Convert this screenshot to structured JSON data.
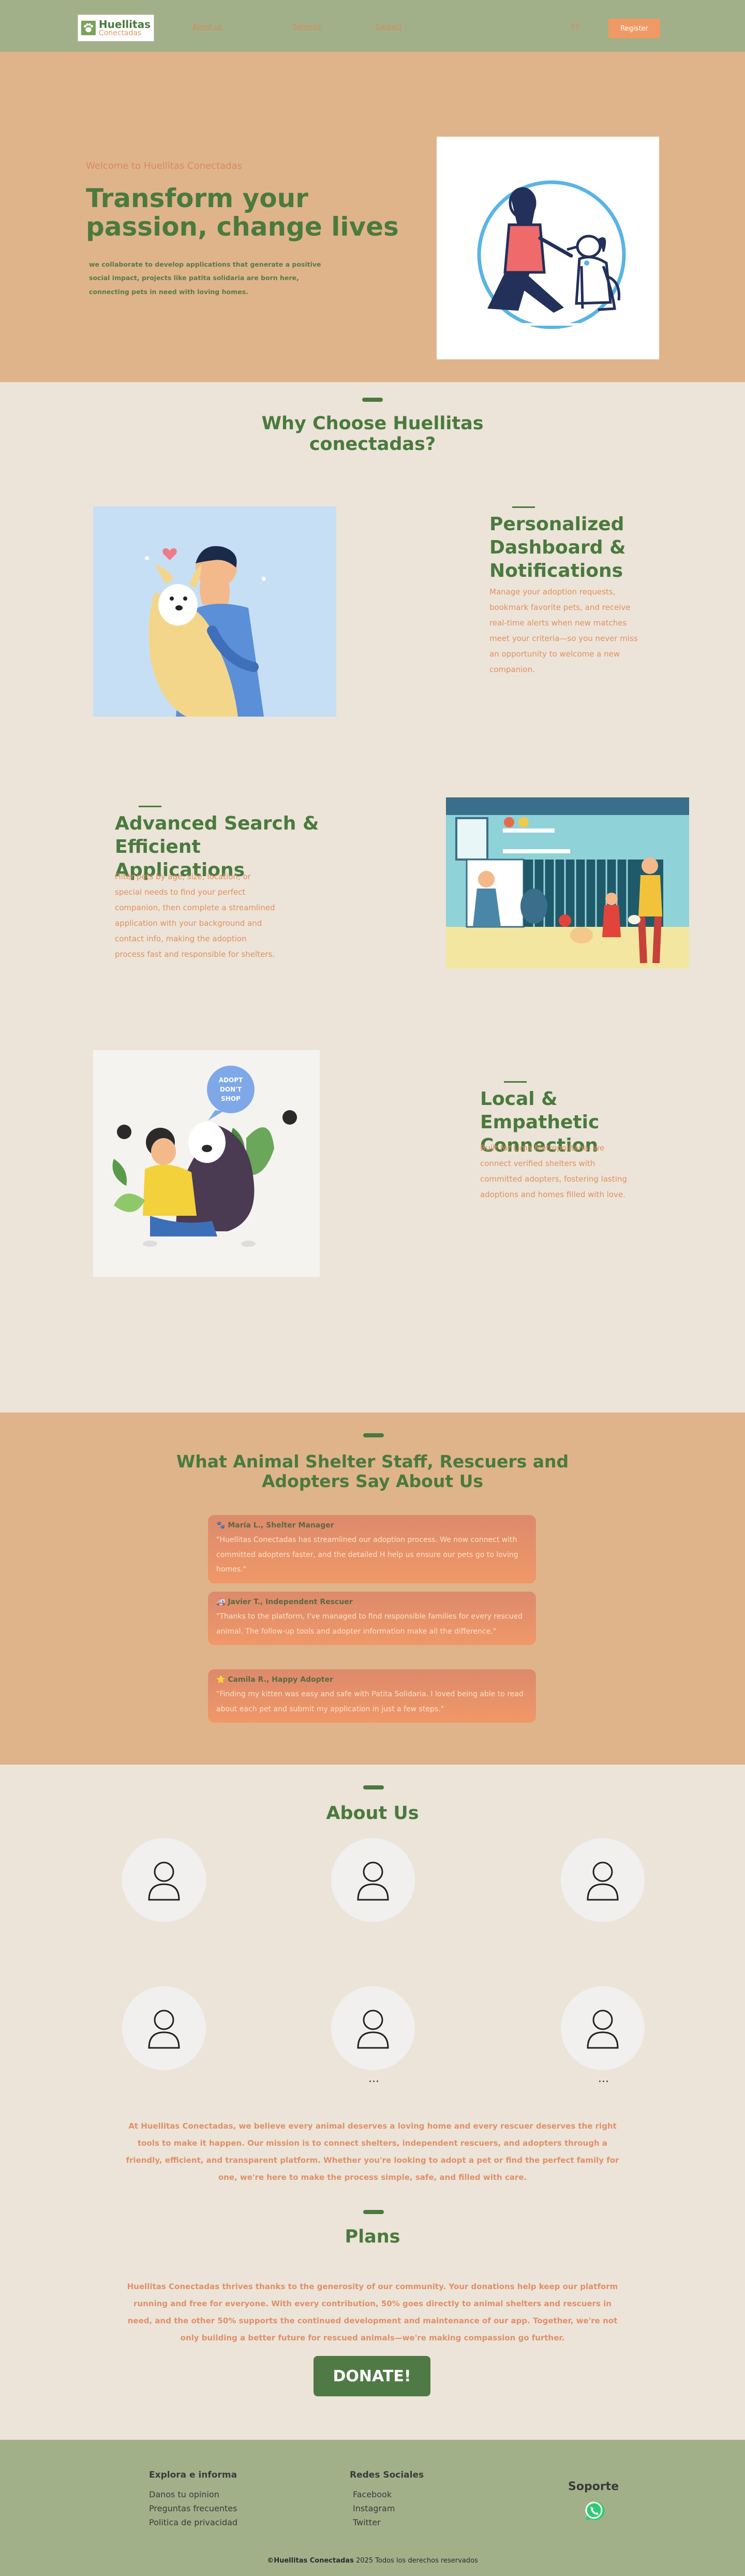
{
  "nav": {
    "logo_line1": "Huellitas",
    "logo_line2": "Conectadas",
    "links": [
      "About us",
      "Services",
      "Contact"
    ],
    "lang": "ES",
    "register": "Register"
  },
  "hero": {
    "kicker": "Welcome to Huellitas Conectadas",
    "title": "Transform your passion, change lives",
    "desc": "we collaborate to develop applications that generate a positive social impact, projects like patita solidaria are born here, connecting pets in need with loving homes."
  },
  "why": {
    "title": "Why Choose Huellitas conectadas?",
    "features": [
      {
        "title": "Personalized Dashboard & Notifications",
        "text": "Manage your adoption requests, bookmark favorite pets, and receive real-time alerts when new matches meet your criteria—so you never miss an opportunity to welcome a new companion."
      },
      {
        "title": "Advanced Search & Efficient Applications",
        "text": "Filter pets by age, size, location, or special needs to find your perfect companion, then complete a streamlined application with your background and contact info, making the adoption process fast and responsible for shelters."
      },
      {
        "title": "Local & Empathetic Connection",
        "text": "Built for Lima Metropolitana, we connect verified shelters with committed adopters, fostering lasting adoptions and homes filled with love."
      }
    ],
    "adopt_badge": "ADOPT DON'T SHOP"
  },
  "testimonials": {
    "title": "What Animal Shelter Staff, Rescuers and Adopters Say About Us",
    "items": [
      {
        "icon": "🐾",
        "name": "María L., Shelter Manager",
        "quote": "\"Huellitas Conectadas has streamlined our adoption process. We now connect with committed adopters faster, and the detailed H help us ensure our pets go to loving homes.\""
      },
      {
        "icon": "🚑",
        "name": "Javier T., Independent Rescuer",
        "quote": "\"Thanks to the platform, I've managed to find responsible families for every rescued animal. The follow-up tools and adopter information make all the difference.\""
      },
      {
        "icon": "⭐",
        "name": "Camila R., Happy Adopter",
        "quote": "\"Finding my kitten was easy and safe with Patita Solidaria. I loved being able to read about each pet and submit my application in just a few steps.\""
      }
    ]
  },
  "about": {
    "title": "About Us",
    "dots": "...",
    "text": "At Huellitas Conectadas, we believe every animal deserves a loving home and every rescuer deserves the right tools to make it happen. Our mission is to connect shelters, independent rescuers, and adopters through a friendly, efficient, and transparent platform. Whether you're looking to adopt a pet or find the perfect family for one, we're here to make the process simple, safe, and filled with care.",
    "plans_title": "Plans",
    "plans_text": "Huellitas Conectadas thrives thanks to the generosity of our community. Your donations help keep our platform running and free for everyone. With every contribution, 50% goes directly to animal shelters and rescuers in need, and the other 50% supports the continued development and maintenance of our app. Together, we're not only building a better future for rescued animals—we're making compassion go further.",
    "donate": "DONATE!"
  },
  "footer": {
    "explore_title": "Explora e informa",
    "explore_items": [
      "Danos tu opinion",
      "Preguntas frecuentes",
      "Politica de privacidad"
    ],
    "social_title": "Redes Sociales",
    "social_items": [
      "Facebook",
      "Instagram",
      "Twitter"
    ],
    "support_title": "Soporte",
    "copyright_brand": "©Huellitas Conectadas",
    "copyright_rest": " 2025 Todos los derechos reservados"
  },
  "colors": {
    "nav_bg": "#a2b08a",
    "hero_bg": "#dfb48b",
    "page_bg": "#ece4d8",
    "green": "#4a7a3e",
    "orange": "#ef9a64"
  }
}
